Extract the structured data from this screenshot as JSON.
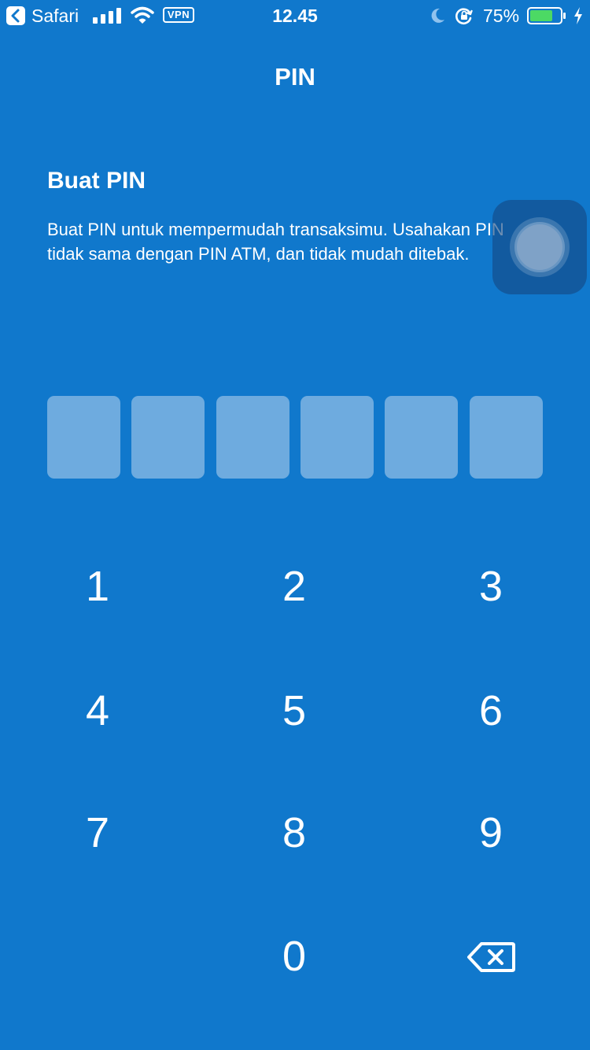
{
  "status_bar": {
    "back_app": "Safari",
    "vpn": "VPN",
    "time": "12.45",
    "battery_percent": "75%",
    "battery_level": 0.75,
    "battery_color": "#4cd964"
  },
  "nav": {
    "title": "PIN"
  },
  "content": {
    "heading": "Buat PIN",
    "description": "Buat PIN untuk mempermudah transaksimu. Usahakan PIN tidak sama dengan PIN ATM, dan tidak mudah ditebak."
  },
  "pin": {
    "length": 6,
    "entered": 0
  },
  "keypad": {
    "keys": [
      "1",
      "2",
      "3",
      "4",
      "5",
      "6",
      "7",
      "8",
      "9",
      "",
      "0",
      "delete"
    ],
    "k1": "1",
    "k2": "2",
    "k3": "3",
    "k4": "4",
    "k5": "5",
    "k6": "6",
    "k7": "7",
    "k8": "8",
    "k9": "9",
    "k0": "0",
    "delete_icon": "backspace-icon"
  },
  "colors": {
    "background": "#1078cc",
    "pin_box": "#6eabdf",
    "text": "#ffffff"
  }
}
